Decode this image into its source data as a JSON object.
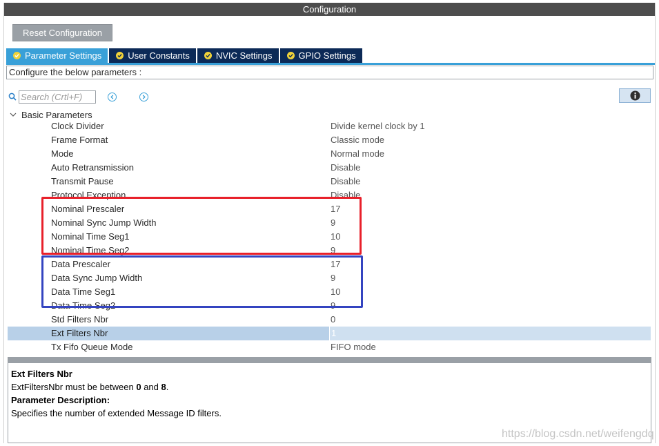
{
  "window": {
    "title": "Configuration"
  },
  "toolbar": {
    "reset_label": "Reset Configuration"
  },
  "tabs": [
    {
      "label": "Parameter Settings",
      "active": true
    },
    {
      "label": "User Constants",
      "active": false
    },
    {
      "label": "NVIC Settings",
      "active": false
    },
    {
      "label": "GPIO Settings",
      "active": false
    }
  ],
  "configure_text": "Configure the below parameters :",
  "search": {
    "placeholder": "Search (Crtl+F)",
    "value": ""
  },
  "icons": {
    "search": "search-icon",
    "prev": "chevron-left-icon",
    "next": "chevron-right-icon",
    "info": "info-icon",
    "expand": "chevron-down-icon",
    "tab_check": "check-circle-icon"
  },
  "colors": {
    "tab_active": "#39a0d8",
    "tab_inactive": "#0c2a57",
    "red_box": "#e8202a",
    "blue_box": "#3444c0",
    "selected_row": "#b8d0e8"
  },
  "tree": {
    "group_label": "Basic Parameters",
    "rows": [
      {
        "name": "Clock Divider",
        "value": "Divide kernel clock by 1"
      },
      {
        "name": "Frame Format",
        "value": "Classic mode"
      },
      {
        "name": "Mode",
        "value": "Normal mode"
      },
      {
        "name": "Auto Retransmission",
        "value": "Disable"
      },
      {
        "name": "Transmit Pause",
        "value": "Disable"
      },
      {
        "name": "Protocol Exception",
        "value": "Disable"
      },
      {
        "name": "Nominal Prescaler",
        "value": "17"
      },
      {
        "name": "Nominal Sync Jump Width",
        "value": "9"
      },
      {
        "name": "Nominal Time Seg1",
        "value": "10"
      },
      {
        "name": "Nominal Time Seg2",
        "value": "9"
      },
      {
        "name": "Data Prescaler",
        "value": "17"
      },
      {
        "name": "Data Sync Jump Width",
        "value": "9"
      },
      {
        "name": "Data Time Seg1",
        "value": "10"
      },
      {
        "name": "Data Time Seg2",
        "value": "9"
      },
      {
        "name": "Std Filters Nbr",
        "value": "0"
      },
      {
        "name": "Ext Filters Nbr",
        "value": "1",
        "selected": true
      },
      {
        "name": "Tx Fifo Queue Mode",
        "value": "FIFO mode"
      }
    ]
  },
  "description": {
    "title": "Ext Filters Nbr",
    "line_prefix": "ExtFiltersNbr must be between ",
    "min": "0",
    "line_middle": " and ",
    "max": "8",
    "line_suffix": ".",
    "section_label": "Parameter Description:",
    "text": "Specifies the number of extended Message ID filters."
  },
  "watermark": "https://blog.csdn.net/weifengdq"
}
